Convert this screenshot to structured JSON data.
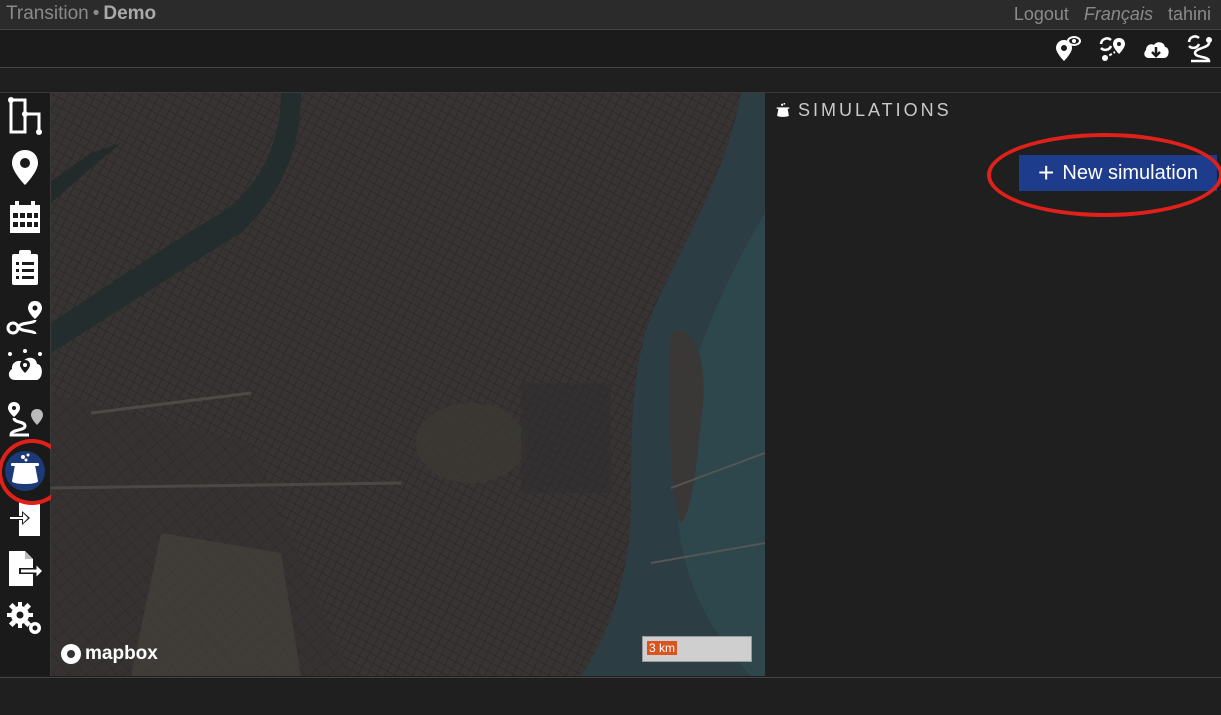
{
  "header": {
    "app_name": "Transition",
    "separator": "•",
    "project": "Demo",
    "logout": "Logout",
    "language": "Français",
    "username": "tahini"
  },
  "toolbar": {
    "icons": [
      "visible-nodes-icon",
      "route-update-icon",
      "download-icon",
      "path-refresh-icon"
    ]
  },
  "sidebar": {
    "items": [
      {
        "name": "network-icon"
      },
      {
        "name": "nodes-icon"
      },
      {
        "name": "schedules-icon"
      },
      {
        "name": "services-icon"
      },
      {
        "name": "routing-icon"
      },
      {
        "name": "accessibility-icon"
      },
      {
        "name": "od-routing-icon"
      },
      {
        "name": "simulations-icon",
        "active": true
      },
      {
        "name": "import-icon"
      },
      {
        "name": "export-icon"
      },
      {
        "name": "settings-icon"
      }
    ]
  },
  "map": {
    "attribution": "mapbox",
    "scale_label": "3 km"
  },
  "panel": {
    "title": "SIMULATIONS",
    "new_button": "New simulation"
  },
  "colors": {
    "accent": "#1e3c8c",
    "highlight": "#e0211b",
    "active_sidebar": "#1c3a78"
  }
}
